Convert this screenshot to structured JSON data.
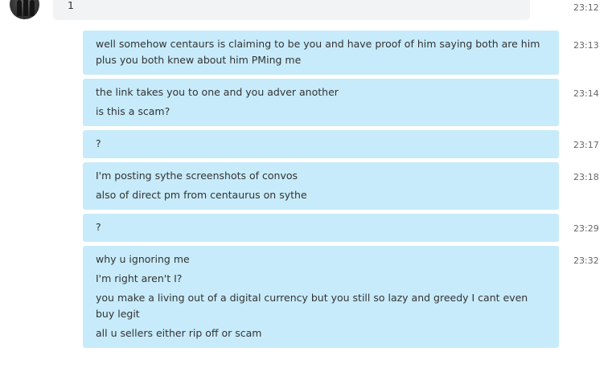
{
  "incoming": {
    "text": "1",
    "time": "23:12"
  },
  "messages": [
    {
      "time": "23:13",
      "lines": [
        "well somehow centaurs is claiming to be you and have proof of him saying both are him",
        "plus you both knew about him PMing me"
      ]
    },
    {
      "time": "23:14",
      "lines": [
        "the link takes you to one and you adver another",
        "is this a scam?"
      ]
    },
    {
      "time": "23:17",
      "lines": [
        "?"
      ]
    },
    {
      "time": "23:18",
      "lines": [
        "I'm posting  sythe screenshots of convos",
        "also of direct pm from centaurus on sythe"
      ]
    },
    {
      "time": "23:29",
      "lines": [
        "?"
      ]
    },
    {
      "time": "23:32",
      "lines": [
        "why u ignoring me",
        "I'm right aren't I?",
        "you make a living out of a digital currency but you still so lazy and greedy I cant even buy legit",
        "all u sellers either rip off or scam"
      ]
    }
  ],
  "colors": {
    "outgoing_bubble": "#c7ebfa",
    "incoming_bubble": "#f2f3f4",
    "timestamp": "#666666"
  }
}
